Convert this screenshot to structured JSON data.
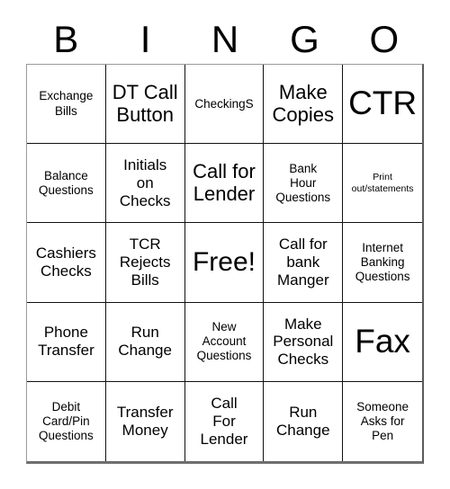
{
  "card": {
    "title": "BINGO",
    "header_letters": [
      "B",
      "I",
      "N",
      "G",
      "O"
    ],
    "colors": {
      "background": "#ffffff",
      "text": "#000000",
      "cell_border": "#111111",
      "outer_border": "#6e6e6e"
    },
    "grid": {
      "columns": 5,
      "rows": 5,
      "free_space_index": 12
    },
    "cells": [
      {
        "text": "Exchange\nBills",
        "size": "sm"
      },
      {
        "text": "DT Call\nButton",
        "size": "lg"
      },
      {
        "text": "CheckingS",
        "size": "sm"
      },
      {
        "text": "Make\nCopies",
        "size": "lg"
      },
      {
        "text": "CTR",
        "size": "xxl"
      },
      {
        "text": "Balance\nQuestions",
        "size": "sm"
      },
      {
        "text": "Initials\non\nChecks",
        "size": "md"
      },
      {
        "text": "Call for\nLender",
        "size": "lg"
      },
      {
        "text": "Bank\nHour\nQuestions",
        "size": "sm"
      },
      {
        "text": "Print\nout/statements",
        "size": "xs"
      },
      {
        "text": "Cashiers\nChecks",
        "size": "md"
      },
      {
        "text": "TCR\nRejects\nBills",
        "size": "md"
      },
      {
        "text": "Free!",
        "size": "xl"
      },
      {
        "text": "Call for\nbank\nManger",
        "size": "md"
      },
      {
        "text": "Internet\nBanking\nQuestions",
        "size": "sm"
      },
      {
        "text": "Phone\nTransfer",
        "size": "md"
      },
      {
        "text": "Run\nChange",
        "size": "md"
      },
      {
        "text": "New\nAccount\nQuestions",
        "size": "sm"
      },
      {
        "text": "Make\nPersonal\nChecks",
        "size": "md"
      },
      {
        "text": "Fax",
        "size": "xxl"
      },
      {
        "text": "Debit\nCard/Pin\nQuestions",
        "size": "sm"
      },
      {
        "text": "Transfer\nMoney",
        "size": "md"
      },
      {
        "text": "Call\nFor\nLender",
        "size": "md"
      },
      {
        "text": "Run\nChange",
        "size": "md"
      },
      {
        "text": "Someone\nAsks for\nPen",
        "size": "sm"
      }
    ]
  }
}
